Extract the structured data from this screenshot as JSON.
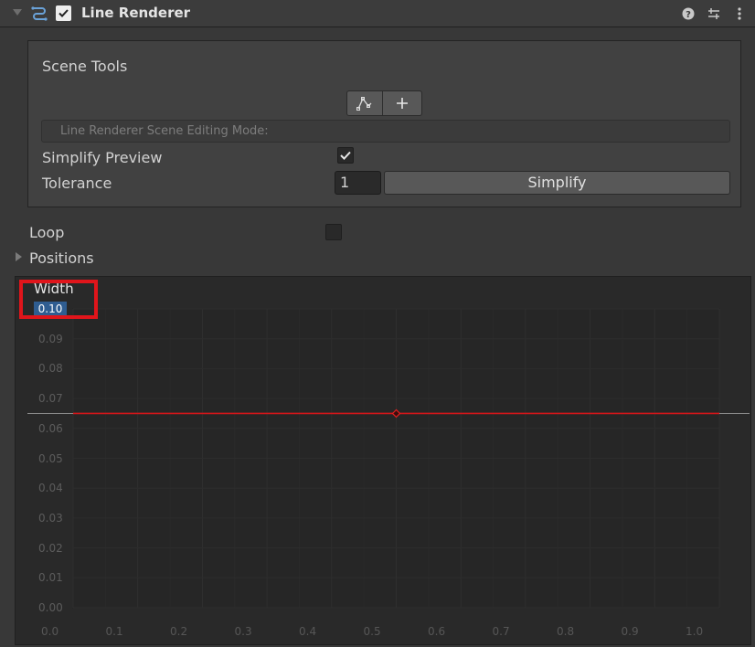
{
  "component": {
    "title": "Line Renderer",
    "enabled": true,
    "icon": "line-renderer-icon"
  },
  "header_buttons": [
    "help-icon",
    "preset-icon",
    "more-icon"
  ],
  "scene_tools": {
    "title": "Scene Tools",
    "tool_buttons": [
      "edit-points-icon",
      "add-point-icon"
    ],
    "mode_placeholder": "Line Renderer Scene Editing Mode:",
    "simplify_preview_label": "Simplify Preview",
    "simplify_preview_checked": true,
    "tolerance_label": "Tolerance",
    "tolerance_value": "1",
    "simplify_button": "Simplify"
  },
  "loop": {
    "label": "Loop",
    "checked": false
  },
  "positions": {
    "label": "Positions",
    "expanded": false
  },
  "width_curve": {
    "label": "Width",
    "value": "0.10",
    "curve_color": "#d4161a"
  },
  "chart_data": {
    "type": "line",
    "title": "Width",
    "xlim": [
      0.0,
      1.0
    ],
    "ylim": [
      0.0,
      0.1
    ],
    "x_ticks": [
      "0.0",
      "0.1",
      "0.2",
      "0.3",
      "0.4",
      "0.5",
      "0.6",
      "0.7",
      "0.8",
      "0.9",
      "1.0"
    ],
    "y_ticks": [
      "0.00",
      "0.01",
      "0.02",
      "0.03",
      "0.04",
      "0.05",
      "0.06",
      "0.07",
      "0.08",
      "0.09"
    ],
    "series": [
      {
        "color": "#d4161a",
        "x": [
          0.0,
          1.0
        ],
        "y": [
          0.065,
          0.065
        ]
      }
    ],
    "keyframes": [
      {
        "x": 0.5,
        "y": 0.065
      }
    ]
  }
}
